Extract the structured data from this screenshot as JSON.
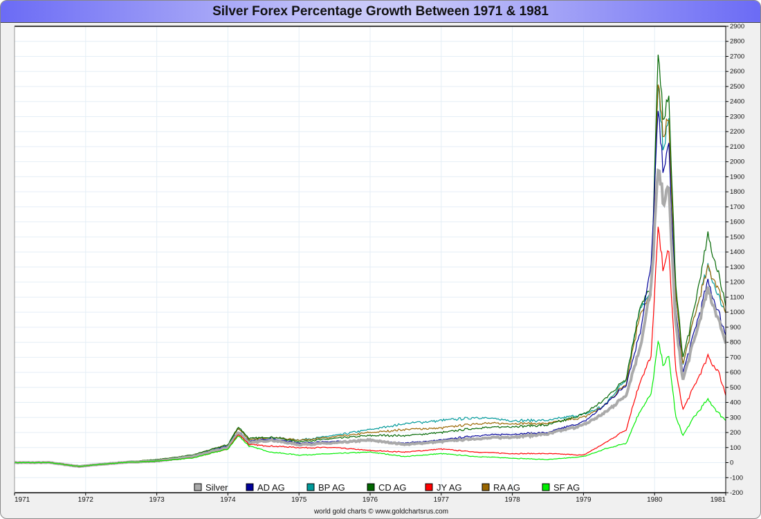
{
  "chart_data": {
    "type": "line",
    "title": "Silver Forex Percentage Growth Between 1971 & 1981",
    "credit": "world gold charts © www.goldchartsrus.com",
    "xlim": [
      1971,
      1981
    ],
    "ylim": [
      -200,
      2900
    ],
    "xticks": [
      "1971",
      "1972",
      "1973",
      "1974",
      "1975",
      "1976",
      "1977",
      "1978",
      "1979",
      "1980",
      "1981"
    ],
    "yticks": [
      -200,
      -100,
      0,
      100,
      200,
      300,
      400,
      500,
      600,
      700,
      800,
      900,
      1000,
      1100,
      1200,
      1300,
      1400,
      1500,
      1600,
      1700,
      1800,
      1900,
      2000,
      2100,
      2200,
      2300,
      2400,
      2500,
      2600,
      2700,
      2800,
      2900
    ],
    "grid": true,
    "legend_position": "bottom",
    "x": [
      1971,
      1971.5,
      1971.9,
      1972.5,
      1973,
      1973.5,
      1974,
      1974.15,
      1974.3,
      1974.6,
      1975,
      1975.5,
      1976,
      1976.5,
      1977,
      1977.5,
      1978,
      1978.5,
      1979,
      1979.3,
      1979.6,
      1979.8,
      1979.95,
      1980.05,
      1980.12,
      1980.2,
      1980.3,
      1980.4,
      1980.55,
      1980.75,
      1980.9,
      1981
    ],
    "series": [
      {
        "name": "BP AG",
        "color": "#009999",
        "values": [
          0,
          0,
          -20,
          0,
          15,
          45,
          110,
          230,
          150,
          170,
          150,
          180,
          220,
          260,
          280,
          300,
          280,
          280,
          320,
          380,
          560,
          1050,
          1100,
          2500,
          2100,
          2250,
          1100,
          650,
          950,
          1300,
          1100,
          1000
        ]
      },
      {
        "name": "RA AG",
        "color": "#996600",
        "values": [
          0,
          0,
          -20,
          5,
          20,
          50,
          120,
          230,
          150,
          170,
          150,
          170,
          200,
          220,
          230,
          260,
          260,
          260,
          300,
          380,
          530,
          1000,
          1100,
          2500,
          2200,
          2250,
          1100,
          650,
          950,
          1300,
          1150,
          1000
        ]
      },
      {
        "name": "CD AG",
        "color": "#006600",
        "values": [
          0,
          0,
          -20,
          5,
          20,
          50,
          120,
          240,
          160,
          170,
          140,
          160,
          180,
          180,
          200,
          230,
          240,
          250,
          320,
          420,
          560,
          1050,
          1150,
          2700,
          2300,
          2400,
          1150,
          700,
          1000,
          1500,
          1250,
          1050
        ]
      },
      {
        "name": "AD AG",
        "color": "#000099",
        "values": [
          0,
          0,
          -25,
          0,
          15,
          45,
          110,
          210,
          140,
          160,
          130,
          140,
          150,
          130,
          150,
          180,
          190,
          200,
          270,
          380,
          520,
          880,
          1300,
          2350,
          1950,
          2100,
          1000,
          600,
          850,
          1200,
          1000,
          850
        ]
      },
      {
        "name": "Silver",
        "color": "#aaaaaa",
        "values": [
          0,
          0,
          -25,
          0,
          10,
          40,
          100,
          200,
          130,
          150,
          120,
          130,
          150,
          120,
          140,
          160,
          170,
          190,
          250,
          330,
          450,
          780,
          1150,
          1950,
          1750,
          1800,
          900,
          550,
          800,
          1150,
          950,
          800
        ]
      },
      {
        "name": "JY AG",
        "color": "#ff0000",
        "values": [
          0,
          0,
          -25,
          0,
          10,
          30,
          90,
          190,
          120,
          110,
          100,
          100,
          80,
          70,
          90,
          70,
          60,
          60,
          50,
          130,
          220,
          550,
          700,
          1550,
          1300,
          1400,
          600,
          350,
          500,
          700,
          600,
          450
        ]
      },
      {
        "name": "SF AG",
        "color": "#00ee00",
        "values": [
          0,
          0,
          -25,
          0,
          10,
          30,
          90,
          180,
          110,
          70,
          50,
          60,
          70,
          40,
          60,
          40,
          30,
          20,
          40,
          90,
          130,
          350,
          450,
          800,
          650,
          700,
          300,
          180,
          300,
          420,
          330,
          280
        ]
      }
    ],
    "legend": [
      {
        "name": "Silver",
        "color": "#aaaaaa"
      },
      {
        "name": "AD AG",
        "color": "#000099"
      },
      {
        "name": "BP AG",
        "color": "#009999"
      },
      {
        "name": "CD AG",
        "color": "#006600"
      },
      {
        "name": "JY AG",
        "color": "#ff0000"
      },
      {
        "name": "RA AG",
        "color": "#996600"
      },
      {
        "name": "SF AG",
        "color": "#00ee00"
      }
    ]
  }
}
